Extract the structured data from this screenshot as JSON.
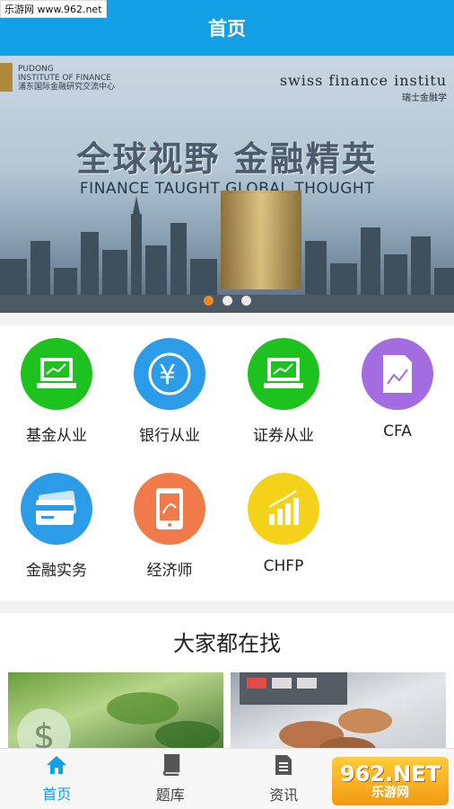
{
  "watermark_top": "乐游网 www.962.net",
  "header": {
    "title": "首页"
  },
  "banner": {
    "logo_line1": "PUDONG",
    "logo_line2": "INSTITUTE OF FINANCE",
    "logo_line3": "浦东国际金融研究交流中心",
    "partner": "swiss finance institu",
    "partner_sub": "瑞士金融学",
    "slogan": "全球视野  金融精英",
    "slogan_en": "FINANCE TAUGHT GLOBAL THOUGHT",
    "active_dot_index": 0,
    "dot_count": 3
  },
  "categories": [
    {
      "label": "基金从业",
      "icon": "monitor-chart-icon",
      "color": "#1ec21e"
    },
    {
      "label": "银行从业",
      "icon": "yen-icon",
      "color": "#2c9be8"
    },
    {
      "label": "证券从业",
      "icon": "monitor-chart-icon",
      "color": "#1ec21e"
    },
    {
      "label": "CFA",
      "icon": "document-chart-icon",
      "color": "#a36ce0"
    },
    {
      "label": "金融实务",
      "icon": "card-icon",
      "color": "#2c9be8"
    },
    {
      "label": "经济师",
      "icon": "phone-icon",
      "color": "#f07a4a"
    },
    {
      "label": "CHFP",
      "icon": "bar-chart-icon",
      "color": "#f4d21a"
    }
  ],
  "section": {
    "title": "大家都在找"
  },
  "tabs": [
    {
      "label": "首页",
      "icon": "home-icon",
      "active": true
    },
    {
      "label": "题库",
      "icon": "book-icon",
      "active": false
    },
    {
      "label": "资讯",
      "icon": "news-icon",
      "active": false
    },
    {
      "label": "",
      "icon": "user-icon",
      "active": false
    }
  ],
  "watermark_bottom": {
    "number": "962.NET",
    "text": "乐游网"
  },
  "colors": {
    "accent": "#14a0e6",
    "active_dot": "#f08a1e"
  }
}
